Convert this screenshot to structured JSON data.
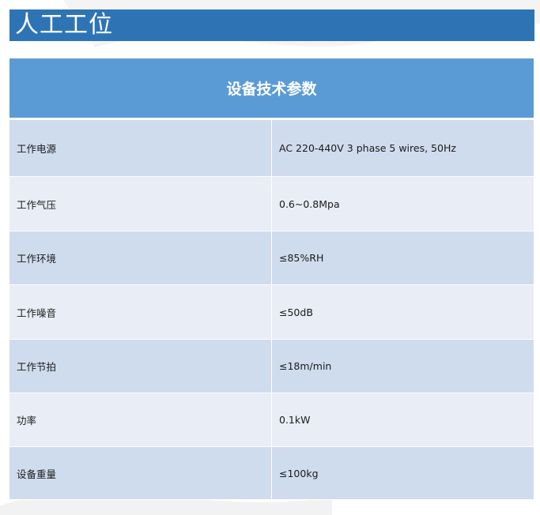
{
  "header": {
    "title": "人工工位"
  },
  "specs": {
    "heading": "设备技术参数",
    "rows": [
      {
        "label": "工作电源",
        "value": "AC 220-440V 3 phase 5 wires, 50Hz"
      },
      {
        "label": "工作气压",
        "value": "0.6~0.8Mpa"
      },
      {
        "label": "工作环境",
        "value": "≤85%RH"
      },
      {
        "label": "工作噪音",
        "value": "≤50dB"
      },
      {
        "label": "工作节拍",
        "value": "≤18m/min"
      },
      {
        "label": "功率",
        "value": "0.1kW"
      },
      {
        "label": "设备重量",
        "value": "≤100kg"
      }
    ]
  },
  "colors": {
    "title_bar": "#2e74b5",
    "table_header": "#5b9bd5",
    "row_dark": "#cfdcee",
    "row_light": "#e8edf6"
  }
}
